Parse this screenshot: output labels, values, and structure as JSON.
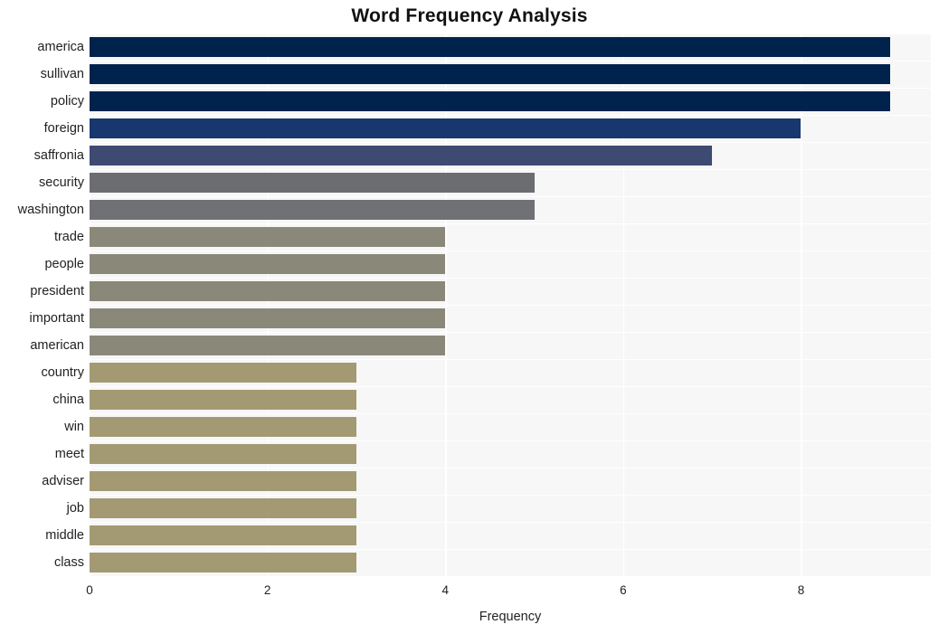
{
  "chart_data": {
    "type": "bar",
    "orientation": "horizontal",
    "title": "Word Frequency Analysis",
    "xlabel": "Frequency",
    "ylabel": "",
    "categories": [
      "america",
      "sullivan",
      "policy",
      "foreign",
      "saffronia",
      "security",
      "washington",
      "trade",
      "people",
      "president",
      "important",
      "american",
      "country",
      "china",
      "win",
      "meet",
      "adviser",
      "job",
      "middle",
      "class"
    ],
    "values": [
      9,
      9,
      9,
      8,
      7,
      5,
      5,
      4,
      4,
      4,
      4,
      4,
      3,
      3,
      3,
      3,
      3,
      3,
      3,
      3
    ],
    "bar_colors": [
      "#00234e",
      "#00234e",
      "#00234e",
      "#17376e",
      "#3e4a72",
      "#6b6d71",
      "#6f7175",
      "#8a8879",
      "#8a8879",
      "#8a8879",
      "#8a8879",
      "#8a8879",
      "#a39a73",
      "#a39a73",
      "#a39a73",
      "#a39a73",
      "#a39a73",
      "#a39a73",
      "#a39a73",
      "#a39a73"
    ],
    "xlim": [
      0,
      9.46
    ],
    "xticks": [
      0,
      2,
      4,
      6,
      8
    ],
    "xtick_labels": [
      "0",
      "2",
      "4",
      "6",
      "8"
    ],
    "grid": true,
    "grid_color": "#ffffff",
    "plot_background": "#f7f7f7",
    "figure_background": "#ffffff",
    "legend": null
  }
}
